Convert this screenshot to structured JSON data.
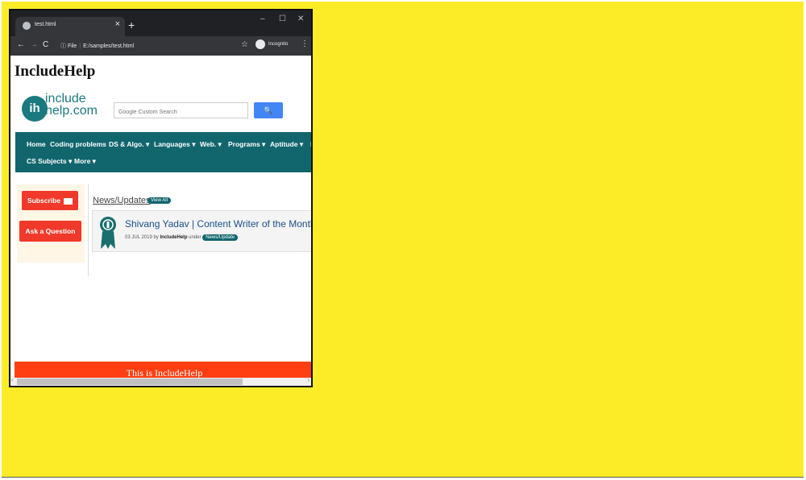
{
  "browser": {
    "tab_title": "test.html",
    "tab_close": "×",
    "new_tab": "+",
    "minimize": "–",
    "maximize": "☐",
    "close": "✕",
    "back": "←",
    "forward": "→",
    "reload": "C",
    "info": "ⓘ",
    "url_scheme": "File",
    "url": "E:/samples/test.html",
    "star": "☆",
    "profile": "Incognito",
    "menu": "⋮"
  },
  "page": {
    "heading": "IncludeHelp",
    "logo_mark": "ih",
    "logo_line1": "include",
    "logo_line2": "help.com",
    "search_placeholder": "Google Custom Search",
    "search_button": "🔍",
    "nav_row1": [
      "Home",
      "Coding problems",
      "DS & Algo. ▾",
      "Languages ▾",
      "Web. ▾",
      "Programs ▾",
      "Aptitude ▾",
      "I"
    ],
    "nav_row2": [
      "CS Subjects ▾",
      "More ▾"
    ],
    "subscribe": "Subscribe",
    "ask_question": "Ask a Question",
    "news_title": "News/Updates",
    "view_all": "View All",
    "article_title": "Shivang Yadav | Content Writer of the Month (Ju",
    "article_date": "03 JUL 2019 by",
    "article_author": "IncludeHelp",
    "article_under": "under",
    "article_tag": "News/Update",
    "footer": "This is IncludeHelp",
    "scroll_left": "‹",
    "scroll_right": "›"
  },
  "colors": {
    "background": "#fcec27",
    "browser_dark": "#202124",
    "teal": "#11666e",
    "red_button": "#f0392a",
    "footer": "#ff3e11",
    "search_button": "#4285f4"
  }
}
